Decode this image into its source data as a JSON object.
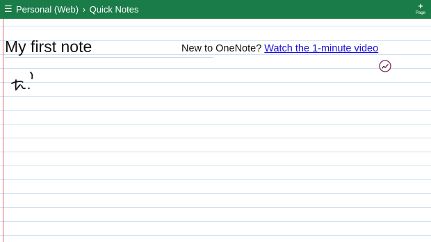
{
  "header": {
    "notebook": "Personal (Web)",
    "separator": "›",
    "section": "Quick Notes",
    "add_page_label": "Page"
  },
  "page": {
    "title": "My first note",
    "promo_text": "New to OneNote?",
    "promo_link": "Watch the 1-minute video"
  },
  "icons": {
    "menu": "hamburger-icon",
    "add": "plus-icon",
    "pen": "pen-icon"
  },
  "colors": {
    "header_bg": "#1a7c48",
    "link": "#1a0dd8",
    "margin": "#e46b6b",
    "rule": "#cfe2f0",
    "pen_badge": "#7a1f5c"
  }
}
